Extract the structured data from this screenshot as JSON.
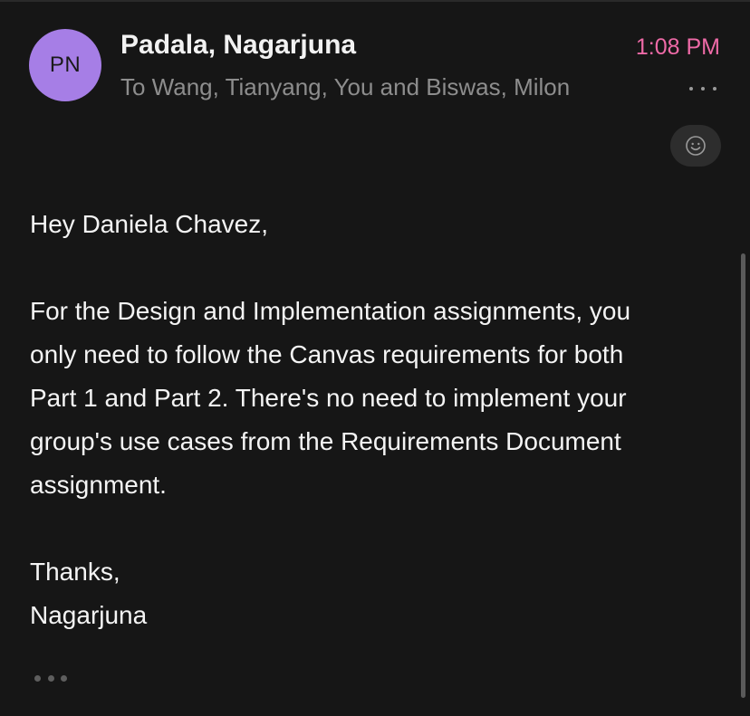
{
  "email": {
    "avatar_initials": "PN",
    "sender_name": "Padala, Nagarjuna",
    "time": "1:08 PM",
    "recipients": "To Wang, Tianyang, You and Biswas, Milon",
    "greeting": "Hey Daniela Chavez,",
    "paragraph_lines": [
      "For the Design and Implementation assignments, you",
      "only need to follow the Canvas requirements for both",
      "Part 1 and Part 2. There's no need to implement your",
      "group's use cases from the Requirements Document",
      "assignment."
    ],
    "signoff": "Thanks,",
    "signature": "Nagarjuna"
  },
  "icons": {
    "header_more": "more-horizontal-icon",
    "reaction": "smiley-face-icon",
    "body_more": "more-horizontal-icon"
  },
  "colors": {
    "background": "#161616",
    "avatar": "#a67ee6",
    "time_accent": "#ee6aa7",
    "secondary_text": "#8d8d8d"
  }
}
